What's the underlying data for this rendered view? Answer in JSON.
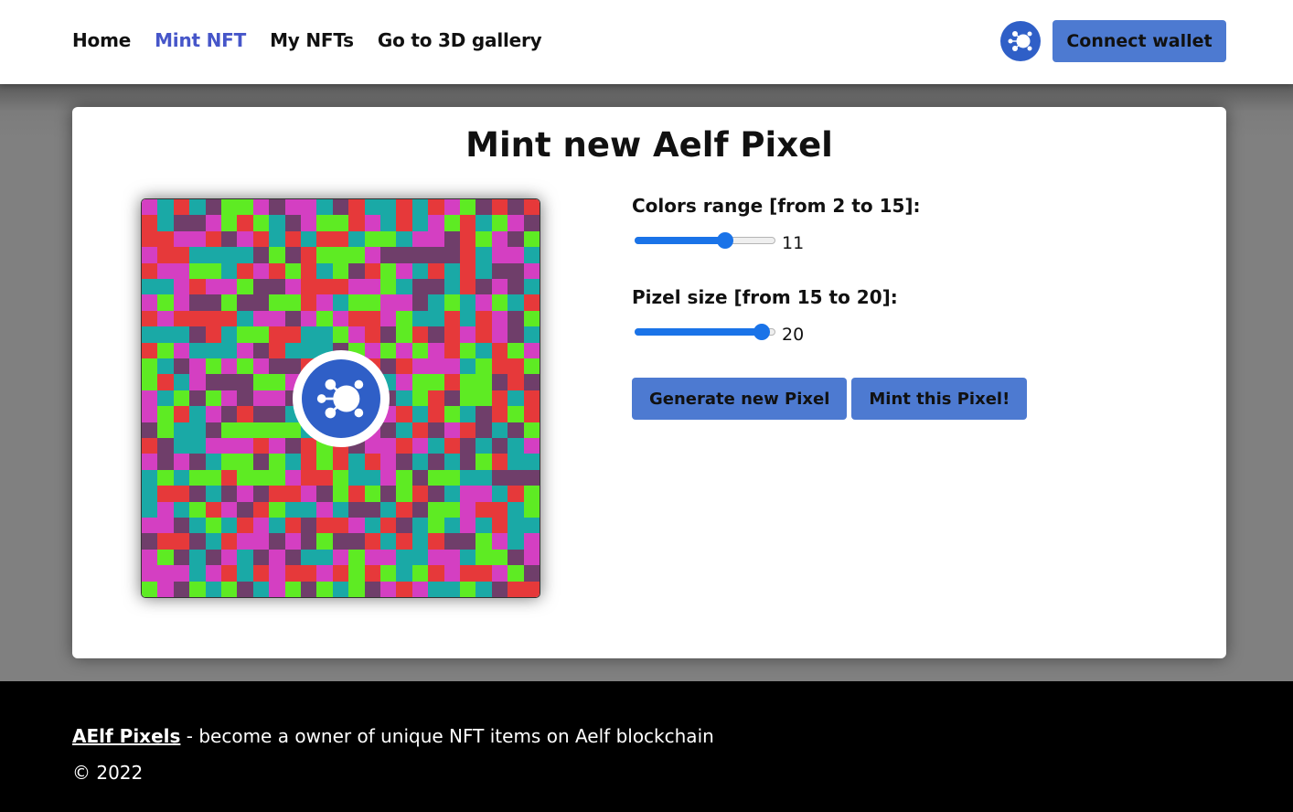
{
  "header": {
    "nav": [
      {
        "label": "Home",
        "active": false
      },
      {
        "label": "Mint NFT",
        "active": true
      },
      {
        "label": "My NFTs",
        "active": false
      },
      {
        "label": "Go to 3D gallery",
        "active": false
      }
    ],
    "logo_icon": "aelf-logo-icon",
    "connect_label": "Connect wallet"
  },
  "main": {
    "title": "Mint new Aelf Pixel",
    "colors_range": {
      "label": "Colors range [from 2 to 15]:",
      "min": 2,
      "max": 15,
      "value": 11,
      "value_text": "11"
    },
    "pixel_size": {
      "label": "Pizel size [from 15 to 20]:",
      "min": 15,
      "max": 20,
      "value": 20,
      "value_text": "20"
    },
    "generate_label": "Generate new Pixel",
    "mint_label": "Mint this Pixel!"
  },
  "pixel_art": {
    "palette": [
      "#e6393a",
      "#1aa9a6",
      "#d43fc2",
      "#5eeb23",
      "#6f3e6a"
    ],
    "center_icon": "aelf-logo-icon"
  },
  "footer": {
    "brand": "AElf Pixels",
    "tagline": " - become a owner of unique NFT items on Aelf blockchain",
    "copyright": "© 2022"
  },
  "colors": {
    "accent": "#4d7ad1",
    "nav_active": "#4656c9",
    "slider": "#1a73e8",
    "logo_blue": "#2f5fc7"
  }
}
